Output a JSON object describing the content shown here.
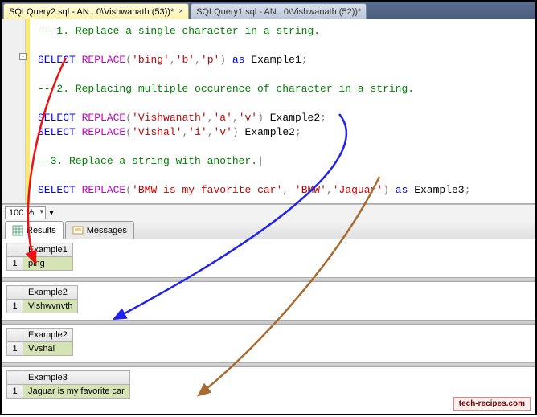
{
  "tabs": [
    {
      "label": "SQLQuery2.sql - AN...0\\Vishwanath (53))*",
      "active": true
    },
    {
      "label": "SQLQuery1.sql - AN...0\\Vishwanath (52))*",
      "active": false
    }
  ],
  "code": {
    "c1": "-- 1. Replace a single character in a string.",
    "l1_select": "SELECT",
    "l1_fn": "REPLACE",
    "l1_open": "(",
    "l1_a1": "'bing'",
    "l1_sep1": ",",
    "l1_a2": "'b'",
    "l1_sep2": ",",
    "l1_a3": "'p'",
    "l1_close": ")",
    "l1_as": "as",
    "l1_alias": "Example1",
    "l1_end": ";",
    "c2": "-- 2. Replacing multiple occurence of character in a string.",
    "l2_select": "SELECT",
    "l2_fn": "REPLACE",
    "l2_open": "(",
    "l2_a1": "'Vishwanath'",
    "l2_sep1": ",",
    "l2_a2": "'a'",
    "l2_sep2": ",",
    "l2_a3": "'v'",
    "l2_close": ")",
    "l2_alias": "Example2",
    "l2_end": ";",
    "l3_select": "SELECT",
    "l3_fn": "REPLACE",
    "l3_open": "(",
    "l3_a1": "'Vishal'",
    "l3_sep1": ",",
    "l3_a2": "'i'",
    "l3_sep2": ",",
    "l3_a3": "'v'",
    "l3_close": ")",
    "l3_alias": "Example2",
    "l3_end": ";",
    "c3": "--3. Replace a string with another.",
    "l4_select": "SELECT",
    "l4_fn": "REPLACE",
    "l4_open": "(",
    "l4_a1": "'BMW is my favorite car'",
    "l4_sep1": ", ",
    "l4_a2": "'BMW'",
    "l4_sep2": ",",
    "l4_a3": "'Jaguar'",
    "l4_close": ")",
    "l4_as": "as",
    "l4_alias": "Example3",
    "l4_end": ";"
  },
  "zoom": {
    "value": "100 %"
  },
  "results_tabs": {
    "results": "Results",
    "messages": "Messages"
  },
  "grids": [
    {
      "header": "Example1",
      "row": "1",
      "value": "ping"
    },
    {
      "header": "Example2",
      "row": "1",
      "value": "Vishwvnvth"
    },
    {
      "header": "Example2",
      "row": "1",
      "value": "Vvshal"
    },
    {
      "header": "Example3",
      "row": "1",
      "value": "Jaguar is my favorite car"
    }
  ],
  "watermark": "tech-recipes.com"
}
